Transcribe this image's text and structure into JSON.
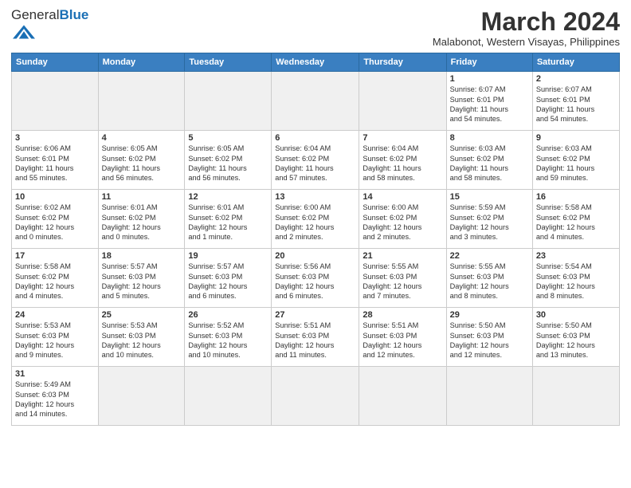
{
  "logo": {
    "text_general": "General",
    "text_blue": "Blue"
  },
  "header": {
    "month_year": "March 2024",
    "location": "Malabonot, Western Visayas, Philippines"
  },
  "weekdays": [
    "Sunday",
    "Monday",
    "Tuesday",
    "Wednesday",
    "Thursday",
    "Friday",
    "Saturday"
  ],
  "weeks": [
    [
      {
        "day": "",
        "info": "",
        "empty": true
      },
      {
        "day": "",
        "info": "",
        "empty": true
      },
      {
        "day": "",
        "info": "",
        "empty": true
      },
      {
        "day": "",
        "info": "",
        "empty": true
      },
      {
        "day": "",
        "info": "",
        "empty": true
      },
      {
        "day": "1",
        "info": "Sunrise: 6:07 AM\nSunset: 6:01 PM\nDaylight: 11 hours\nand 54 minutes."
      },
      {
        "day": "2",
        "info": "Sunrise: 6:07 AM\nSunset: 6:01 PM\nDaylight: 11 hours\nand 54 minutes."
      }
    ],
    [
      {
        "day": "3",
        "info": "Sunrise: 6:06 AM\nSunset: 6:01 PM\nDaylight: 11 hours\nand 55 minutes."
      },
      {
        "day": "4",
        "info": "Sunrise: 6:05 AM\nSunset: 6:02 PM\nDaylight: 11 hours\nand 56 minutes."
      },
      {
        "day": "5",
        "info": "Sunrise: 6:05 AM\nSunset: 6:02 PM\nDaylight: 11 hours\nand 56 minutes."
      },
      {
        "day": "6",
        "info": "Sunrise: 6:04 AM\nSunset: 6:02 PM\nDaylight: 11 hours\nand 57 minutes."
      },
      {
        "day": "7",
        "info": "Sunrise: 6:04 AM\nSunset: 6:02 PM\nDaylight: 11 hours\nand 58 minutes."
      },
      {
        "day": "8",
        "info": "Sunrise: 6:03 AM\nSunset: 6:02 PM\nDaylight: 11 hours\nand 58 minutes."
      },
      {
        "day": "9",
        "info": "Sunrise: 6:03 AM\nSunset: 6:02 PM\nDaylight: 11 hours\nand 59 minutes."
      }
    ],
    [
      {
        "day": "10",
        "info": "Sunrise: 6:02 AM\nSunset: 6:02 PM\nDaylight: 12 hours\nand 0 minutes."
      },
      {
        "day": "11",
        "info": "Sunrise: 6:01 AM\nSunset: 6:02 PM\nDaylight: 12 hours\nand 0 minutes."
      },
      {
        "day": "12",
        "info": "Sunrise: 6:01 AM\nSunset: 6:02 PM\nDaylight: 12 hours\nand 1 minute."
      },
      {
        "day": "13",
        "info": "Sunrise: 6:00 AM\nSunset: 6:02 PM\nDaylight: 12 hours\nand 2 minutes."
      },
      {
        "day": "14",
        "info": "Sunrise: 6:00 AM\nSunset: 6:02 PM\nDaylight: 12 hours\nand 2 minutes."
      },
      {
        "day": "15",
        "info": "Sunrise: 5:59 AM\nSunset: 6:02 PM\nDaylight: 12 hours\nand 3 minutes."
      },
      {
        "day": "16",
        "info": "Sunrise: 5:58 AM\nSunset: 6:02 PM\nDaylight: 12 hours\nand 4 minutes."
      }
    ],
    [
      {
        "day": "17",
        "info": "Sunrise: 5:58 AM\nSunset: 6:02 PM\nDaylight: 12 hours\nand 4 minutes."
      },
      {
        "day": "18",
        "info": "Sunrise: 5:57 AM\nSunset: 6:03 PM\nDaylight: 12 hours\nand 5 minutes."
      },
      {
        "day": "19",
        "info": "Sunrise: 5:57 AM\nSunset: 6:03 PM\nDaylight: 12 hours\nand 6 minutes."
      },
      {
        "day": "20",
        "info": "Sunrise: 5:56 AM\nSunset: 6:03 PM\nDaylight: 12 hours\nand 6 minutes."
      },
      {
        "day": "21",
        "info": "Sunrise: 5:55 AM\nSunset: 6:03 PM\nDaylight: 12 hours\nand 7 minutes."
      },
      {
        "day": "22",
        "info": "Sunrise: 5:55 AM\nSunset: 6:03 PM\nDaylight: 12 hours\nand 8 minutes."
      },
      {
        "day": "23",
        "info": "Sunrise: 5:54 AM\nSunset: 6:03 PM\nDaylight: 12 hours\nand 8 minutes."
      }
    ],
    [
      {
        "day": "24",
        "info": "Sunrise: 5:53 AM\nSunset: 6:03 PM\nDaylight: 12 hours\nand 9 minutes."
      },
      {
        "day": "25",
        "info": "Sunrise: 5:53 AM\nSunset: 6:03 PM\nDaylight: 12 hours\nand 10 minutes."
      },
      {
        "day": "26",
        "info": "Sunrise: 5:52 AM\nSunset: 6:03 PM\nDaylight: 12 hours\nand 10 minutes."
      },
      {
        "day": "27",
        "info": "Sunrise: 5:51 AM\nSunset: 6:03 PM\nDaylight: 12 hours\nand 11 minutes."
      },
      {
        "day": "28",
        "info": "Sunrise: 5:51 AM\nSunset: 6:03 PM\nDaylight: 12 hours\nand 12 minutes."
      },
      {
        "day": "29",
        "info": "Sunrise: 5:50 AM\nSunset: 6:03 PM\nDaylight: 12 hours\nand 12 minutes."
      },
      {
        "day": "30",
        "info": "Sunrise: 5:50 AM\nSunset: 6:03 PM\nDaylight: 12 hours\nand 13 minutes."
      }
    ],
    [
      {
        "day": "31",
        "info": "Sunrise: 5:49 AM\nSunset: 6:03 PM\nDaylight: 12 hours\nand 14 minutes."
      },
      {
        "day": "",
        "info": "",
        "empty": true
      },
      {
        "day": "",
        "info": "",
        "empty": true
      },
      {
        "day": "",
        "info": "",
        "empty": true
      },
      {
        "day": "",
        "info": "",
        "empty": true
      },
      {
        "day": "",
        "info": "",
        "empty": true
      },
      {
        "day": "",
        "info": "",
        "empty": true
      }
    ]
  ]
}
